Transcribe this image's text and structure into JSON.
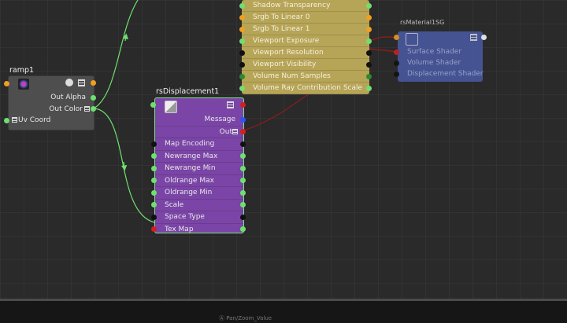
{
  "nodes": {
    "ramp1": {
      "title": "ramp1",
      "outputs": [
        "Out Alpha",
        "Out Color"
      ],
      "inputs": [
        "Uv Coord"
      ]
    },
    "displacement": {
      "title": "rsDisplacement1",
      "outputs": [
        "Message",
        "Out"
      ],
      "attributes": [
        "Map Encoding",
        "Newrange Max",
        "Newrange Min",
        "Oldrange Max",
        "Oldrange Min",
        "Scale",
        "Space Type",
        "Tex Map"
      ]
    },
    "yellow_material": {
      "attributes": [
        "Shadow Transparency",
        "Srgb To Linear 0",
        "Srgb To Linear 1",
        "Viewport Exposure",
        "Viewport Resolution",
        "Viewport Visibility",
        "Volume Num Samples",
        "Volume Ray Contribution Scale"
      ]
    },
    "shading_group": {
      "title": "rsMaterial1SG",
      "attributes": [
        "Surface Shader",
        "Volume Shader",
        "Displacement Shader"
      ]
    }
  },
  "colors": {
    "port_green": "#6fe06f",
    "port_orange": "#f0a020",
    "port_red": "#d02020",
    "port_black": "#111111",
    "port_blue": "#3050ff",
    "wire_green": "#6fe06f",
    "wire_red": "#9a1a1a"
  },
  "footer": {
    "label": "Ⓐ Pan/Zoom_Value"
  }
}
